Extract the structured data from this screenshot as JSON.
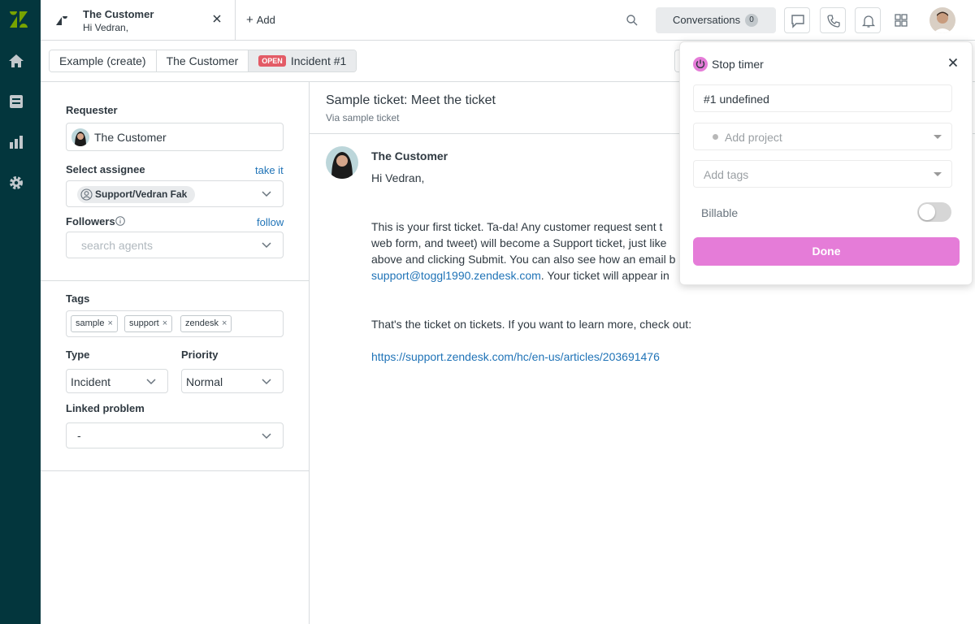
{
  "top_tab": {
    "title": "The Customer",
    "subtitle": "Hi Vedran,"
  },
  "add_tab_label": "Add",
  "conversations": {
    "label": "Conversations",
    "count": "0"
  },
  "breadcrumb": {
    "items": [
      "Example (create)",
      "The Customer"
    ],
    "status_badge": "OPEN",
    "current": "Incident #1"
  },
  "properties": {
    "requester_label": "Requester",
    "requester_value": "The Customer",
    "assignee_label": "Select assignee",
    "assignee_action": "take it",
    "assignee_value": "Support/Vedran Fak",
    "followers_label": "Followers",
    "followers_action": "follow",
    "followers_placeholder": "search agents",
    "tags_label": "Tags",
    "tags": [
      "sample",
      "support",
      "zendesk"
    ],
    "type_label": "Type",
    "type_value": "Incident",
    "priority_label": "Priority",
    "priority_value": "Normal",
    "linked_label": "Linked problem",
    "linked_value": "-"
  },
  "ticket": {
    "subject": "Sample ticket: Meet the ticket",
    "via": "Via sample ticket",
    "author": "The Customer",
    "greeting": "Hi Vedran,",
    "body_line1": "This is your first ticket. Ta-da! Any customer request sent t",
    "body_line2": "web form, and tweet) will become a Support ticket, just like",
    "body_line3": "above and clicking Submit. You can also see how an email b",
    "body_line4_link": "support@toggl1990.zendesk.com",
    "body_line4_text": ". Your ticket will appear in",
    "body_line5": "That's the ticket on tickets. If you want to learn more, check out:",
    "body_link": "https://support.zendesk.com/hc/en-us/articles/203691476"
  },
  "timer": {
    "title": "Stop timer",
    "description": "#1 undefined",
    "project_placeholder": "Add project",
    "tags_placeholder": "Add tags",
    "billable_label": "Billable",
    "billable_on": false,
    "done_label": "Done",
    "accent_color": "#e57cd8"
  },
  "colors": {
    "rail": "#03363d",
    "link": "#1f73b7",
    "open_badge": "#e35b66"
  }
}
